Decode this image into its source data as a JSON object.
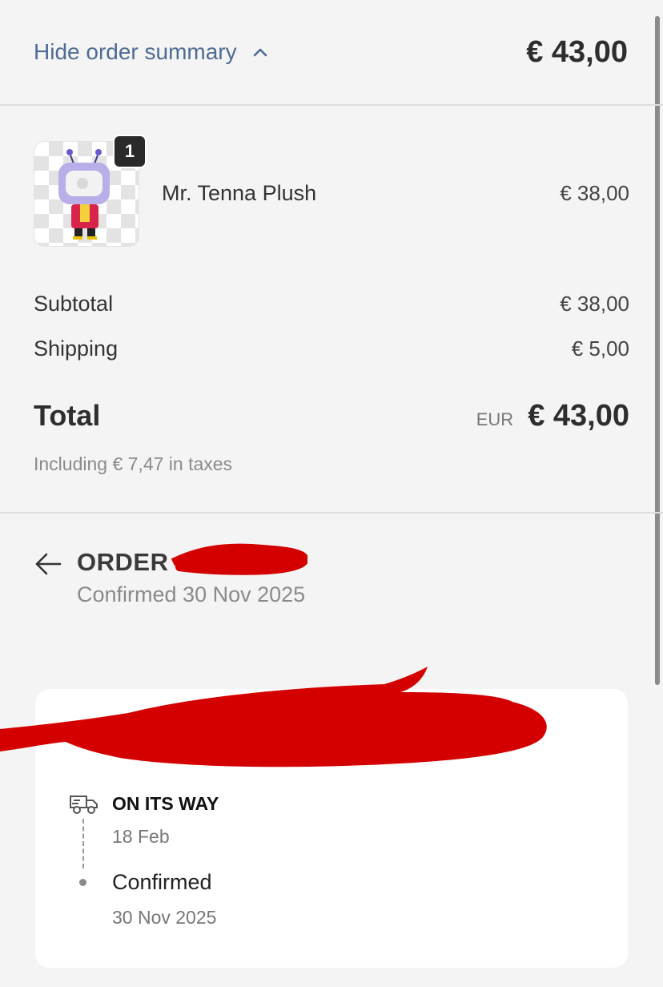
{
  "summary": {
    "toggle_label": "Hide order summary",
    "top_total": "€ 43,00"
  },
  "line_item": {
    "quantity": "1",
    "name": "Mr. Tenna Plush",
    "price": "€ 38,00",
    "image_icon": "product-plush-image"
  },
  "totals": {
    "subtotal_label": "Subtotal",
    "subtotal_value": "€ 38,00",
    "shipping_label": "Shipping",
    "shipping_value": "€ 5,00",
    "total_label": "Total",
    "currency": "EUR",
    "total_value": "€ 43,00",
    "taxes_note": "Including € 7,47 in taxes"
  },
  "order": {
    "title": "ORDER",
    "confirmed_text": "Confirmed 30 Nov 2025"
  },
  "status": {
    "current_title": "ON ITS WAY",
    "current_date": "18 Feb",
    "previous_label": "Confirmed",
    "previous_date": "30 Nov 2025"
  },
  "colors": {
    "accent": "#4f6b94",
    "redaction": "#d40000",
    "background": "#f4f4f4"
  }
}
